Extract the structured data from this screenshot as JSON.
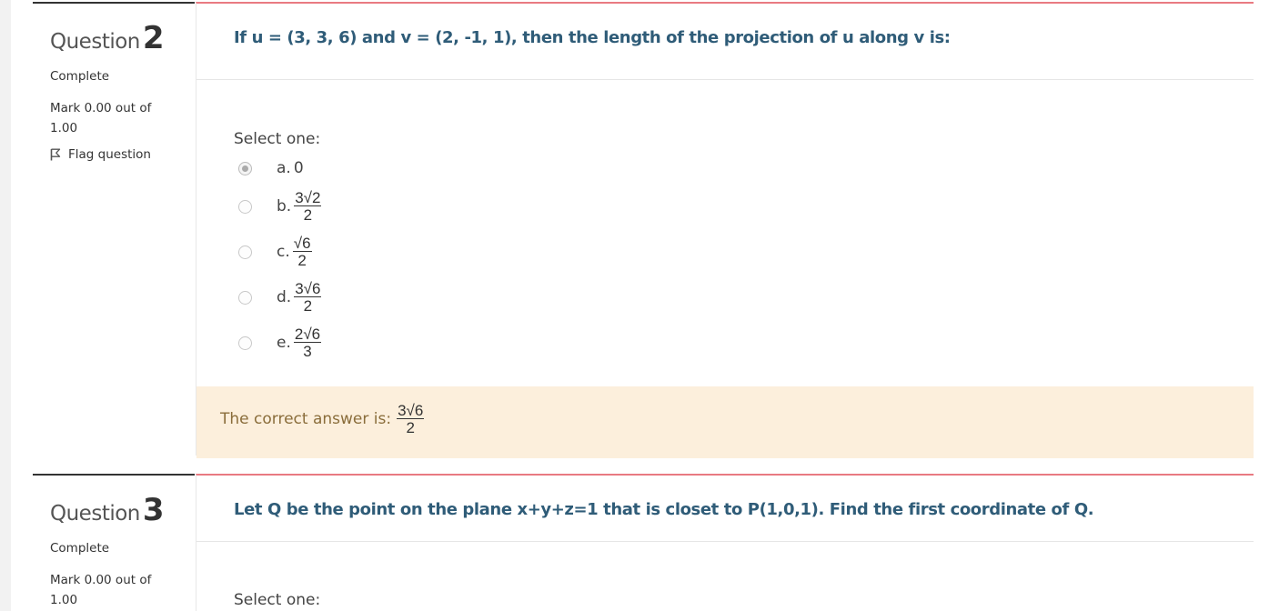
{
  "questions": [
    {
      "label": "Question",
      "number": "2",
      "state": "Complete",
      "grade": "Mark 0.00 out of 1.00",
      "flag": "Flag question",
      "text": "If u = (3, 3, 6) and v = (2, -1, 1), then the length of the projection of u along v is:",
      "prompt": "Select one:",
      "options": [
        {
          "letter": "a.",
          "value": "0",
          "selected": true
        },
        {
          "letter": "b.",
          "numerator": "3√2",
          "denominator": "2",
          "selected": false
        },
        {
          "letter": "c.",
          "numerator": "√6",
          "denominator": "2",
          "selected": false
        },
        {
          "letter": "d.",
          "numerator": "3√6",
          "denominator": "2",
          "selected": false
        },
        {
          "letter": "e.",
          "numerator": "2√6",
          "denominator": "3",
          "selected": false
        }
      ],
      "feedback": {
        "prefix": "The correct answer is:",
        "numerator": "3√6",
        "denominator": "2"
      }
    },
    {
      "label": "Question",
      "number": "3",
      "state": "Complete",
      "grade": "Mark 0.00 out of 1.00",
      "text": "Let Q be the point on the plane x+y+z=1 that is closet to P(1,0,1). Find the first coordinate of Q.",
      "prompt": "Select one:"
    }
  ],
  "colors": {
    "question_text": "#2f5c78",
    "info_border": "#333333",
    "content_border": "#e97a82",
    "feedback_bg": "#fcefdc",
    "feedback_text": "#8a6d3b"
  },
  "icons": {
    "flag": "flag-icon"
  }
}
